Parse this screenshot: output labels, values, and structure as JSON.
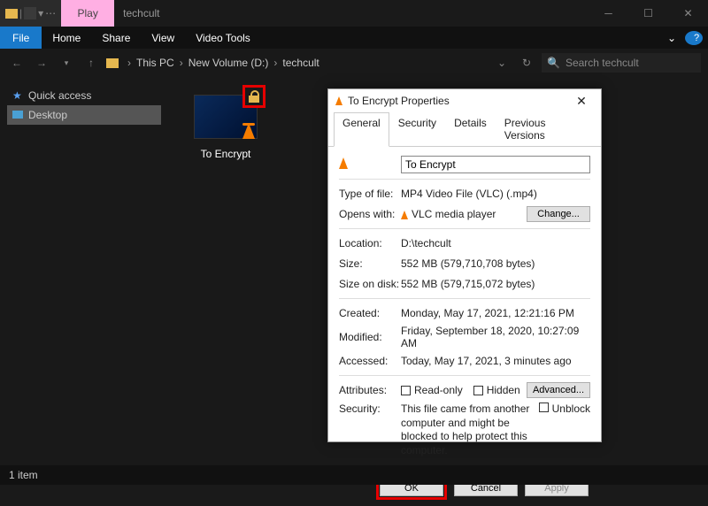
{
  "titlebar": {
    "play_label": "Play",
    "title": "techcult"
  },
  "ribbon": {
    "file": "File",
    "home": "Home",
    "share": "Share",
    "view": "View",
    "video_tools": "Video Tools"
  },
  "address": {
    "root": "This PC",
    "volume": "New Volume (D:)",
    "folder": "techcult"
  },
  "search": {
    "placeholder": "Search techcult"
  },
  "sidebar": {
    "quick_access": "Quick access",
    "desktop": "Desktop"
  },
  "main": {
    "file_name": "To Encrypt"
  },
  "dialog": {
    "title": "To Encrypt Properties",
    "tabs": {
      "general": "General",
      "security": "Security",
      "details": "Details",
      "previous": "Previous Versions"
    },
    "file_name": "To Encrypt",
    "type_lbl": "Type of file:",
    "type_val": "MP4 Video File (VLC) (.mp4)",
    "opens_lbl": "Opens with:",
    "opens_val": "VLC media player",
    "change_btn": "Change...",
    "location_lbl": "Location:",
    "location_val": "D:\\techcult",
    "size_lbl": "Size:",
    "size_val": "552 MB (579,710,708 bytes)",
    "disk_lbl": "Size on disk:",
    "disk_val": "552 MB (579,715,072 bytes)",
    "created_lbl": "Created:",
    "created_val": "Monday, May 17, 2021, 12:21:16 PM",
    "modified_lbl": "Modified:",
    "modified_val": "Friday, September 18, 2020, 10:27:09 AM",
    "accessed_lbl": "Accessed:",
    "accessed_val": "Today, May 17, 2021, 3 minutes ago",
    "attributes_lbl": "Attributes:",
    "readonly": "Read-only",
    "hidden": "Hidden",
    "advanced_btn": "Advanced...",
    "security_lbl": "Security:",
    "security_msg": "This file came from another computer and might be blocked to help protect this computer.",
    "unblock": "Unblock",
    "ok": "OK",
    "cancel": "Cancel",
    "apply": "Apply"
  },
  "status": {
    "count": "1 item"
  }
}
